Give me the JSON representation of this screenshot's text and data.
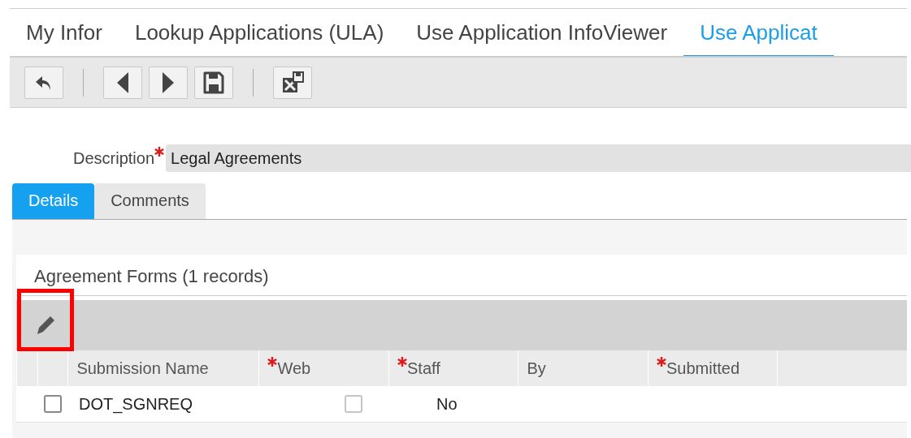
{
  "tabs": [
    {
      "label": "My Infor",
      "selected": false
    },
    {
      "label": "Lookup Applications (ULA)",
      "selected": false
    },
    {
      "label": "Use Application InfoViewer",
      "selected": false
    },
    {
      "label": "Use Applicat",
      "selected": true
    }
  ],
  "toolbar": [
    {
      "kind": "undo"
    },
    {
      "kind": "separator"
    },
    {
      "kind": "previous"
    },
    {
      "kind": "next"
    },
    {
      "kind": "save"
    },
    {
      "kind": "separator"
    },
    {
      "kind": "delete-save"
    }
  ],
  "description": {
    "label": "Description",
    "required": true,
    "value": "Legal Agreements"
  },
  "subtabs": [
    {
      "label": "Details",
      "selected": true
    },
    {
      "label": "Comments",
      "selected": false
    }
  ],
  "grid": {
    "title": "Agreement Forms (1 records)",
    "edit_tool": {
      "highlighted": true
    },
    "columns": [
      {
        "label": "Submission Name",
        "required": false
      },
      {
        "label": "Web",
        "required": true
      },
      {
        "label": "Staff",
        "required": true
      },
      {
        "label": "By",
        "required": false
      },
      {
        "label": "Submitted",
        "required": true
      }
    ],
    "rows": [
      {
        "checked": false,
        "submission_name": "DOT_SGNREQ",
        "web": false,
        "staff": "No"
      }
    ]
  }
}
